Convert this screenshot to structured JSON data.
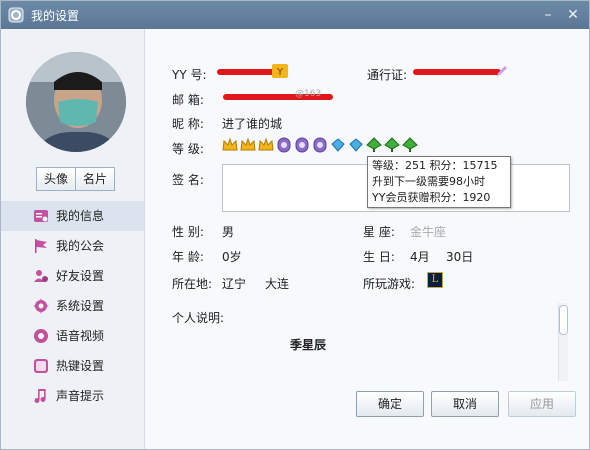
{
  "window": {
    "title": "我的设置",
    "colors": {
      "titlebar": "#5f7c9b",
      "redaction": "#e0161a",
      "level_crown": "#f2b51c",
      "level_moon": "#8a6cc6",
      "level_diamond": "#4ab0e6",
      "level_leaf": "#3fae3a"
    }
  },
  "sidebar": {
    "avatar_btn": "头像",
    "card_btn": "名片",
    "items": [
      {
        "label": "我的信息",
        "icon": "profile-card-icon"
      },
      {
        "label": "我的公会",
        "icon": "flag-icon"
      },
      {
        "label": "好友设置",
        "icon": "friends-gear-icon"
      },
      {
        "label": "系统设置",
        "icon": "gear-icon"
      },
      {
        "label": "语音视频",
        "icon": "microphone-icon"
      },
      {
        "label": "热键设置",
        "icon": "keyboard-icon"
      },
      {
        "label": "声音提示",
        "icon": "music-note-icon"
      }
    ]
  },
  "profile": {
    "yy_label": "YY  号:",
    "pass_label": "通行证:",
    "email_label": "邮   箱:",
    "email_fragment": "@163",
    "nickname_label": "昵   称:",
    "nickname": "进了谁的城",
    "level_label": "等   级:",
    "signature_label": "签   名:",
    "gender_label": "性   别:",
    "gender": "男",
    "zodiac_label": "星   座:",
    "zodiac": "金牛座",
    "age_label": "年   龄:",
    "age": "0岁",
    "birthday_label": "生   日:",
    "birthday_month": "4月",
    "birthday_day": "30日",
    "location_label": "所在地:",
    "province": "辽宁",
    "city": "大连",
    "games_label": "所玩游戏:",
    "desc_label": "个人说明:",
    "desc_text": "季星辰"
  },
  "tooltip": {
    "line1": "等级：251  积分：15715",
    "line2": "升到下一级需要98小时",
    "line3": "YY会员获赠积分：1920"
  },
  "footer": {
    "ok": "确定",
    "cancel": "取消",
    "apply": "应用"
  }
}
